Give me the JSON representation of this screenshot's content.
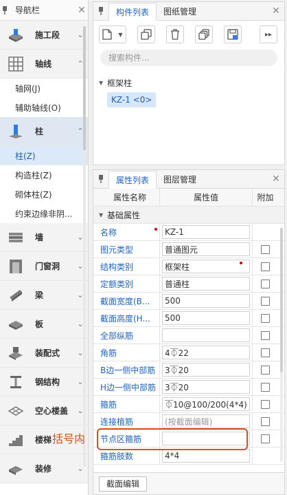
{
  "nav": {
    "title": "导航栏",
    "categories": [
      {
        "label": "施工段",
        "icon": "construction-stage-icon"
      },
      {
        "label": "轴线",
        "icon": "grid-axis-icon",
        "subitems": [
          "轴网(J)",
          "辅助轴线(O)"
        ]
      },
      {
        "label": "柱",
        "icon": "column-icon",
        "subitems": [
          "柱(Z)",
          "构造柱(Z)",
          "砌体柱(Z)",
          "约束边缘非阴..."
        ]
      },
      {
        "label": "墙",
        "icon": "wall-icon"
      },
      {
        "label": "门窗洞",
        "icon": "door-window-icon"
      },
      {
        "label": "梁",
        "icon": "beam-icon"
      },
      {
        "label": "板",
        "icon": "slab-icon"
      },
      {
        "label": "装配式",
        "icon": "prefab-icon"
      },
      {
        "label": "钢结构",
        "icon": "steel-structure-icon"
      },
      {
        "label": "空心楼盖",
        "icon": "hollow-floor-icon"
      },
      {
        "label": "楼梯",
        "icon": "stair-icon"
      },
      {
        "label": "装修",
        "icon": "decoration-icon"
      }
    ]
  },
  "component_panel": {
    "tabs": [
      "构件列表",
      "图纸管理"
    ],
    "search_placeholder": "搜索构件...",
    "tree_root": "框架柱",
    "tree_leaf": "KZ-1 <0>"
  },
  "property_panel": {
    "tabs": [
      "属性列表",
      "图层管理"
    ],
    "headers": [
      "属性名称",
      "属性值",
      "附加"
    ],
    "group": "基础属性",
    "rows": [
      {
        "name": "名称",
        "value": "KZ-1",
        "checkbox": false
      },
      {
        "name": "图元类型",
        "value": "普通图元",
        "checkbox": true
      },
      {
        "name": "结构类别",
        "value": "框架柱",
        "checkbox": true
      },
      {
        "name": "定额类别",
        "value": "普通柱",
        "checkbox": true
      },
      {
        "name": "截面宽度(B...",
        "value": "500",
        "checkbox": true
      },
      {
        "name": "截面高度(H...",
        "value": "500",
        "checkbox": true
      },
      {
        "name": "全部纵筋",
        "value": "",
        "checkbox": true
      },
      {
        "name": "角筋",
        "value": "4⏁22",
        "checkbox": true
      },
      {
        "name": "B边一侧中部筋",
        "value": "3⏁20",
        "checkbox": true
      },
      {
        "name": "H边一侧中部筋",
        "value": "3⏁20",
        "checkbox": true
      },
      {
        "name": "箍筋",
        "value": "⏁10@100/200(4*4)",
        "checkbox": true
      },
      {
        "name": "连接植筋",
        "value": "(按截面编辑)",
        "checkbox": true
      },
      {
        "name": "节点区箍筋",
        "value": "",
        "checkbox": true
      },
      {
        "name": "箍筋肢数",
        "value": "4*4",
        "checkbox": false
      }
    ],
    "bottom_button": "截面编辑"
  },
  "annotation": {
    "text": "括号内",
    "color": "#d9531e"
  },
  "colors": {
    "accent": "#1a64c7",
    "selection": "#dbe9f8",
    "required_dot": "#e00000"
  }
}
